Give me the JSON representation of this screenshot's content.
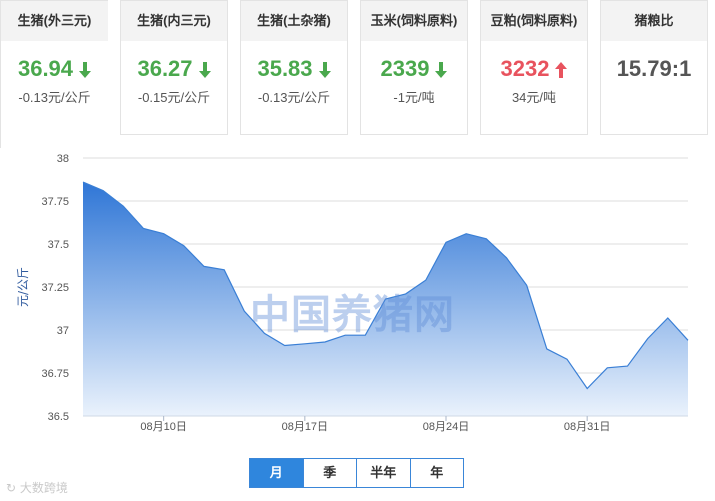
{
  "cards": [
    {
      "title": "生猪(外三元)",
      "price": "36.94",
      "direction": "down",
      "change": "-0.13元/公斤"
    },
    {
      "title": "生猪(内三元)",
      "price": "36.27",
      "direction": "down",
      "change": "-0.15元/公斤"
    },
    {
      "title": "生猪(土杂猪)",
      "price": "35.83",
      "direction": "down",
      "change": "-0.13元/公斤"
    },
    {
      "title": "玉米(饲料原料)",
      "price": "2339",
      "direction": "down",
      "change": "-1元/吨"
    },
    {
      "title": "豆粕(饲料原料)",
      "price": "3232",
      "direction": "up",
      "change": "34元/吨"
    },
    {
      "title": "猪粮比",
      "price": "15.79:1",
      "direction": "none",
      "change": ""
    }
  ],
  "colors": {
    "down": "#4aa84d",
    "up": "#e8535e",
    "line": "#3a7fd5",
    "fill_top": "#2f76d6",
    "fill_bottom": "#eaf2fc"
  },
  "watermark": "中国养猪网",
  "logo_text": "大数跨境",
  "range_buttons": [
    {
      "label": "月",
      "active": true
    },
    {
      "label": "季",
      "active": false
    },
    {
      "label": "半年",
      "active": false
    },
    {
      "label": "年",
      "active": false
    }
  ],
  "chart_data": {
    "type": "area",
    "ylabel": "元/公斤",
    "ylim": [
      36.5,
      38
    ],
    "yticks": [
      "38",
      "37.75",
      "37.5",
      "37.25",
      "37",
      "36.75",
      "36.5"
    ],
    "xtick_labels": [
      {
        "day": 4,
        "label": "08月10日"
      },
      {
        "day": 11,
        "label": "08月17日"
      },
      {
        "day": 18,
        "label": "08月24日"
      },
      {
        "day": 25,
        "label": "08月31日"
      }
    ],
    "x_days": [
      0,
      1,
      2,
      3,
      4,
      5,
      6,
      7,
      8,
      9,
      10,
      11,
      12,
      13,
      14,
      15,
      16,
      17,
      18,
      19,
      20,
      21,
      22,
      23,
      24,
      25,
      26,
      27,
      28,
      29,
      30
    ],
    "values": [
      37.86,
      37.81,
      37.72,
      37.59,
      37.56,
      37.49,
      37.37,
      37.35,
      37.11,
      36.98,
      36.91,
      36.92,
      36.93,
      36.97,
      36.97,
      37.18,
      37.21,
      37.29,
      37.51,
      37.56,
      37.53,
      37.42,
      37.26,
      36.89,
      36.83,
      36.66,
      36.78,
      36.79,
      36.95,
      37.07,
      36.94
    ],
    "grid": true,
    "legend": "none"
  }
}
